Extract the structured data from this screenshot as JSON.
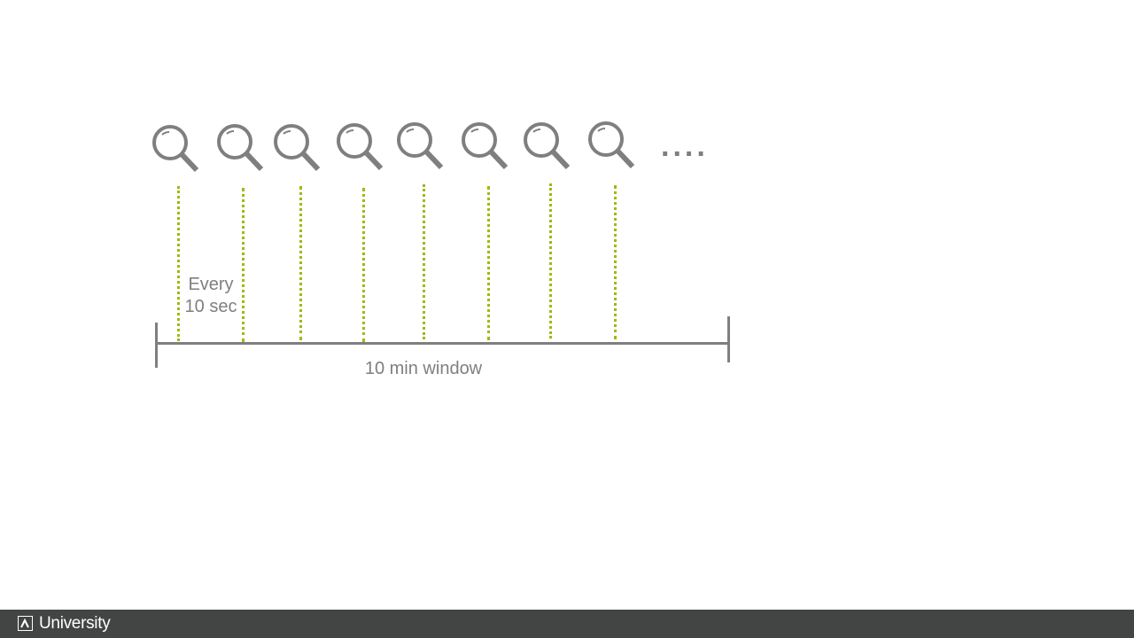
{
  "diagram": {
    "every_label_line1": "Every",
    "every_label_line2": "10 sec",
    "window_label": "10 min window",
    "ellipsis": "....",
    "icons": [
      "search-icon",
      "search-icon",
      "search-icon",
      "search-icon",
      "search-icon",
      "search-icon",
      "search-icon",
      "search-icon"
    ],
    "colors": {
      "icon": "#7f7f7f",
      "dotted_line": "#9bbb12",
      "timeline": "#7f7f7f",
      "text": "#7f7f7f"
    }
  },
  "footer": {
    "brand": "University",
    "background": "#434444"
  }
}
